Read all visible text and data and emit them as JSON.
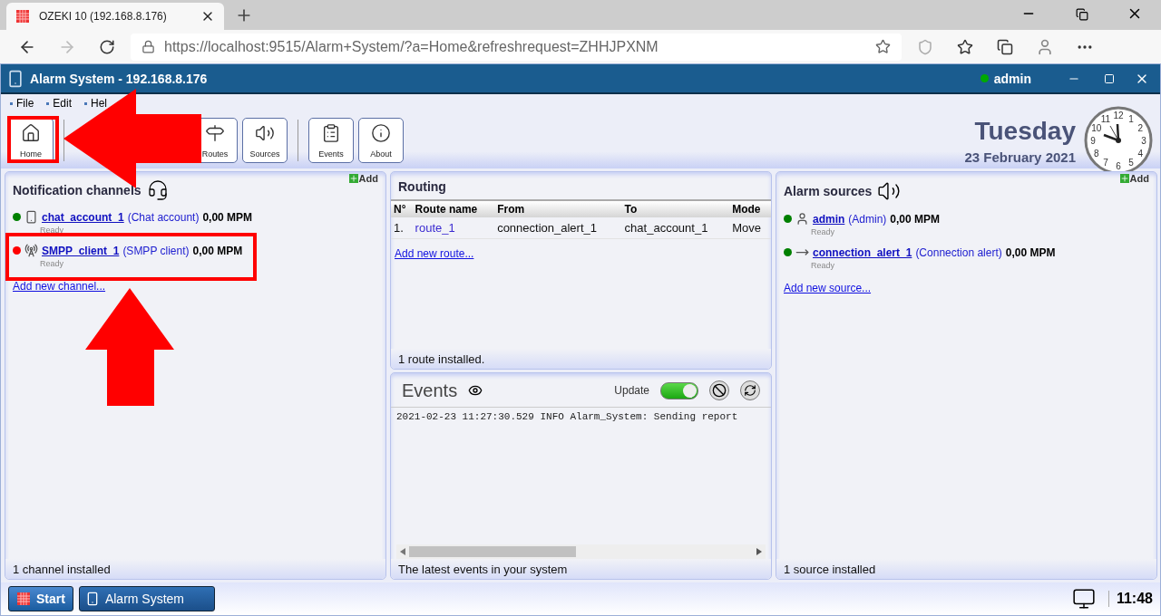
{
  "browser": {
    "tab_title": "OZEKI 10 (192.168.8.176)",
    "url": "https://localhost:9515/Alarm+System/?a=Home&refreshrequest=ZHHJPXNM"
  },
  "app": {
    "title": "Alarm System - 192.168.8.176",
    "user": "admin",
    "user_online": true
  },
  "menu": [
    "File",
    "Edit",
    "Hel"
  ],
  "toolbar": [
    {
      "kind": "button",
      "label": "Home"
    },
    {
      "kind": "separator"
    },
    {
      "kind": "blank"
    },
    {
      "kind": "button",
      "label": "Routes"
    },
    {
      "kind": "button",
      "label": "Sources"
    },
    {
      "kind": "separator"
    },
    {
      "kind": "button",
      "label": "Events"
    },
    {
      "kind": "button",
      "label": "About"
    }
  ],
  "date": {
    "day": "Tuesday",
    "date": "23 February 2021"
  },
  "clock_numbers": [
    "12",
    "11",
    "1",
    "10",
    "2",
    "9",
    "3",
    "8",
    "4",
    "7",
    "5",
    "6"
  ],
  "channels": {
    "title": "Notification channels",
    "add": "Add",
    "items": [
      {
        "name": "chat_account_1",
        "type": "(Chat account)",
        "rate": "0,00 MPM",
        "status": "Ready",
        "color": "#008000"
      },
      {
        "name": "SMPP_client_1",
        "type": "(SMPP client)",
        "rate": "0,00 MPM",
        "status": "Ready",
        "color": "#ff0000"
      }
    ],
    "add_link": "Add new channel...",
    "footer": "1 channel installed"
  },
  "routing": {
    "title": "Routing",
    "columns": [
      "N°",
      "Route name",
      "From",
      "To",
      "Mode"
    ],
    "rows": [
      [
        "1.",
        "route_1",
        "connection_alert_1",
        "chat_account_1",
        "Move"
      ]
    ],
    "add_link": "Add new route...",
    "footer": "1 route installed."
  },
  "events": {
    "title": "Events",
    "update_label": "Update",
    "update_on": true,
    "log": [
      "2021-02-23 11:27:30.529 INFO Alarm_System: Sending report"
    ],
    "footer": "The latest events in your system"
  },
  "sources": {
    "title": "Alarm sources",
    "add": "Add",
    "items": [
      {
        "name": "admin",
        "type": "(Admin)",
        "rate": "0,00 MPM",
        "status": "Ready",
        "color": "#008000"
      },
      {
        "name": "connection_alert_1",
        "type": "(Connection alert)",
        "rate": "0,00 MPM",
        "status": "Ready",
        "color": "#008000"
      }
    ],
    "add_link": "Add new source...",
    "footer": "1 source installed"
  },
  "taskbar": {
    "start": "Start",
    "task": "Alarm System",
    "time": "11:48"
  }
}
